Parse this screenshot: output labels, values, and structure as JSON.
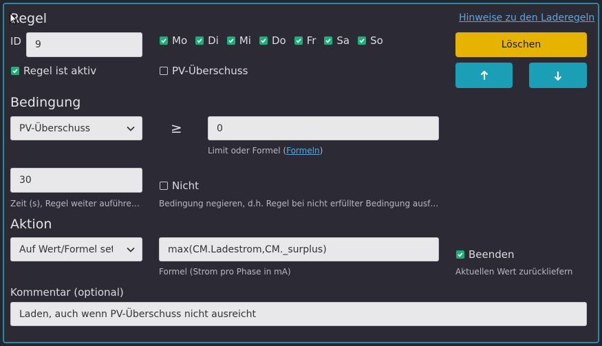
{
  "regel": {
    "title": "Regel",
    "id_label": "ID",
    "id_value": "9",
    "days": [
      {
        "label": "Mo",
        "checked": true
      },
      {
        "label": "Di",
        "checked": true
      },
      {
        "label": "Mi",
        "checked": true
      },
      {
        "label": "Do",
        "checked": true
      },
      {
        "label": "Fr",
        "checked": true
      },
      {
        "label": "Sa",
        "checked": true
      },
      {
        "label": "So",
        "checked": true
      }
    ],
    "active_label": "Regel ist aktiv",
    "active_checked": true,
    "pv_label": "PV-Überschuss",
    "pv_checked": false,
    "hint_link": "Hinweise zu den Laderegeln",
    "delete_label": "Löschen"
  },
  "bedingung": {
    "title": "Bedingung",
    "select_value": "PV-Überschuss",
    "operator": "≥",
    "limit_value": "0",
    "limit_hint_prefix": "Limit oder Formel (",
    "limit_hint_link": "Formeln",
    "limit_hint_suffix": ")",
    "time_value": "30",
    "time_hint": "Zeit (s), Regel weiter auführen ...",
    "not_label": "Nicht",
    "not_checked": false,
    "not_hint": "Bedingung negieren, d.h. Regel bei nicht erfüllter Bedingung ausführ..."
  },
  "aktion": {
    "title": "Aktion",
    "select_value": "Auf Wert/Formel setzen",
    "formula_value": "max(CM.Ladestrom,CM._surplus)",
    "formula_hint": "Formel (Strom pro Phase in mA)",
    "end_label": "Beenden",
    "end_checked": true,
    "end_hint": "Aktuellen Wert zurückliefern"
  },
  "kommentar": {
    "label": "Kommentar (optional)",
    "value": "Laden, auch wenn PV-Überschuss nicht ausreicht"
  },
  "colors": {
    "accent": "#1a9fb6",
    "warning": "#e6b400",
    "check": "#1bb07a"
  }
}
